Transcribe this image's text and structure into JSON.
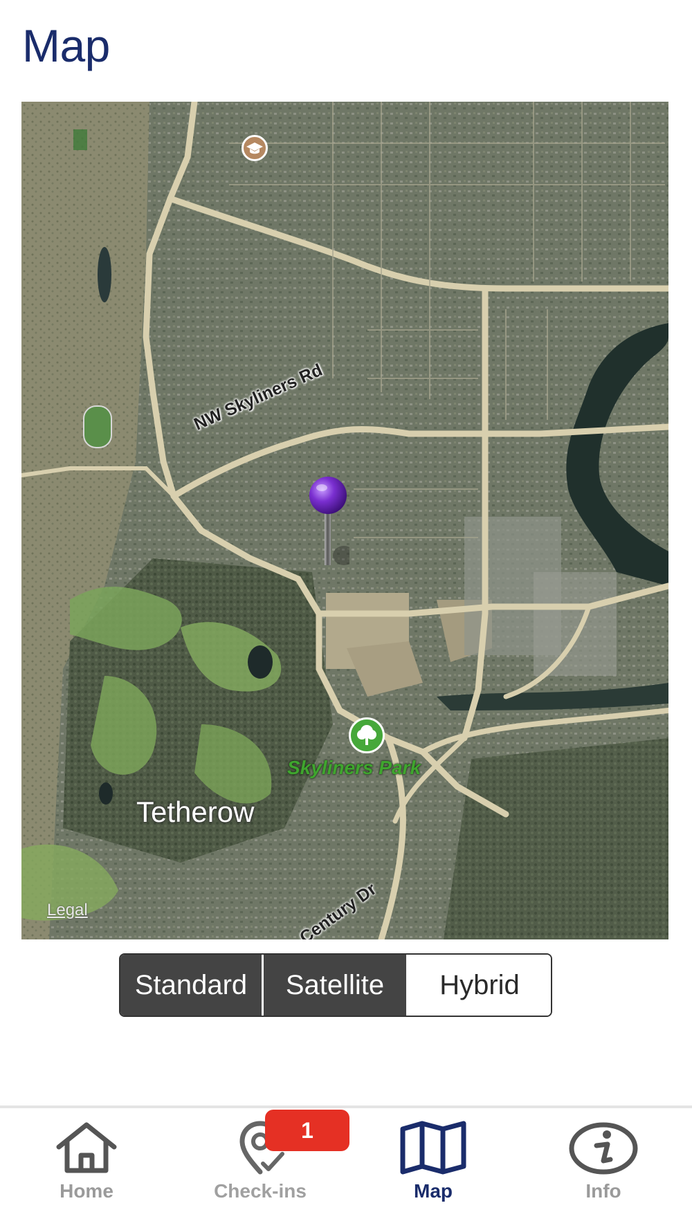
{
  "header": {
    "title": "Map"
  },
  "map": {
    "labels": {
      "road_skyliners": "NW Skyliners Rd",
      "road_century": "Century Dr",
      "park": "Skyliners Park",
      "area": "Tetherow",
      "legal": "Legal"
    },
    "icons": {
      "pin": "purple-pin-icon",
      "park": "tree-icon",
      "school": "graduation-cap-icon"
    },
    "colors": {
      "pin": "#7a2fd0",
      "park_marker": "#46a83a",
      "school_marker": "#b58861"
    }
  },
  "map_type_control": {
    "options": [
      "Standard",
      "Satellite",
      "Hybrid"
    ],
    "selected": "Hybrid"
  },
  "tabbar": {
    "items": [
      {
        "label": "Home",
        "icon": "home-icon"
      },
      {
        "label": "Check-ins",
        "icon": "checkin-pin-icon",
        "badge": "1"
      },
      {
        "label": "Map",
        "icon": "map-icon"
      },
      {
        "label": "Info",
        "icon": "info-icon"
      }
    ],
    "active": "Map",
    "colors": {
      "active": "#1a2c6b",
      "inactive": "#9a9a9a",
      "badge": "#e53024"
    }
  }
}
